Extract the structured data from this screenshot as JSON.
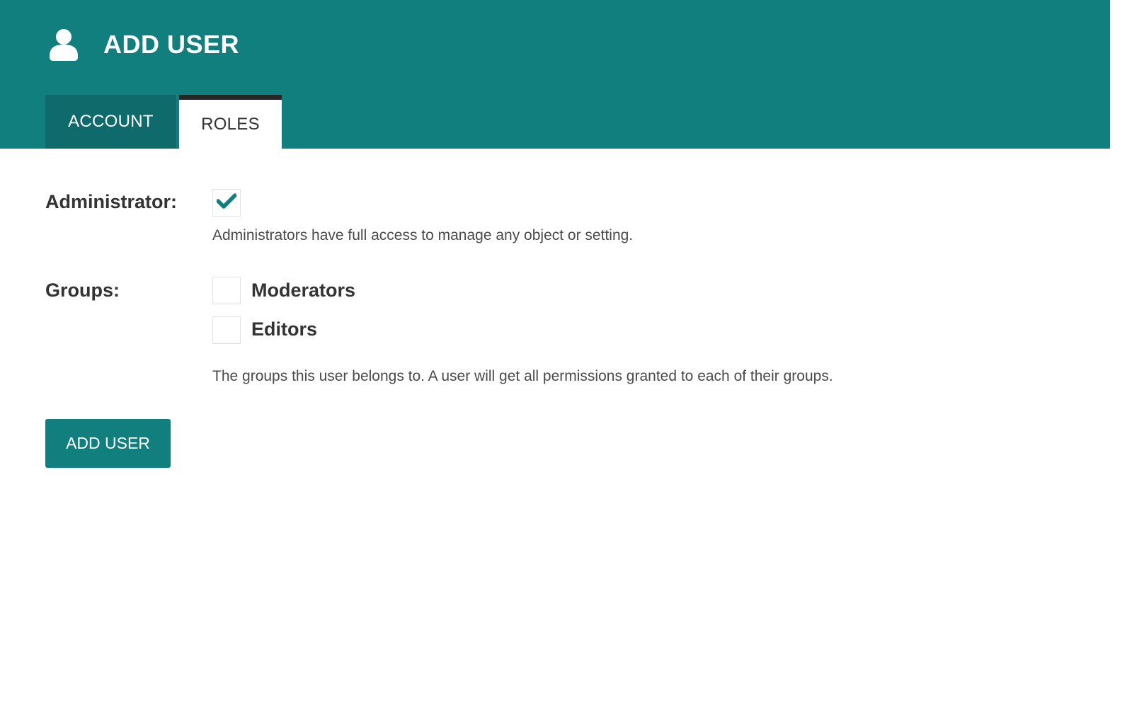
{
  "header": {
    "icon": "user-icon",
    "title": "ADD USER",
    "background_color": "#127f7f"
  },
  "tabs": [
    {
      "label": "ACCOUNT",
      "active": false
    },
    {
      "label": "ROLES",
      "active": true
    }
  ],
  "form": {
    "administrator": {
      "label": "Administrator:",
      "checked": true,
      "help_text": "Administrators have full access to manage any object or setting."
    },
    "groups": {
      "label": "Groups:",
      "options": [
        {
          "label": "Moderators",
          "checked": false
        },
        {
          "label": "Editors",
          "checked": false
        }
      ],
      "help_text": "The groups this user belongs to. A user will get all permissions granted to each of their groups."
    },
    "submit_label": "ADD USER"
  },
  "colors": {
    "accent": "#127f7f",
    "tab_inactive": "#0f6a6c",
    "tab_active_border": "#262626",
    "checkmark": "#127f7f"
  }
}
